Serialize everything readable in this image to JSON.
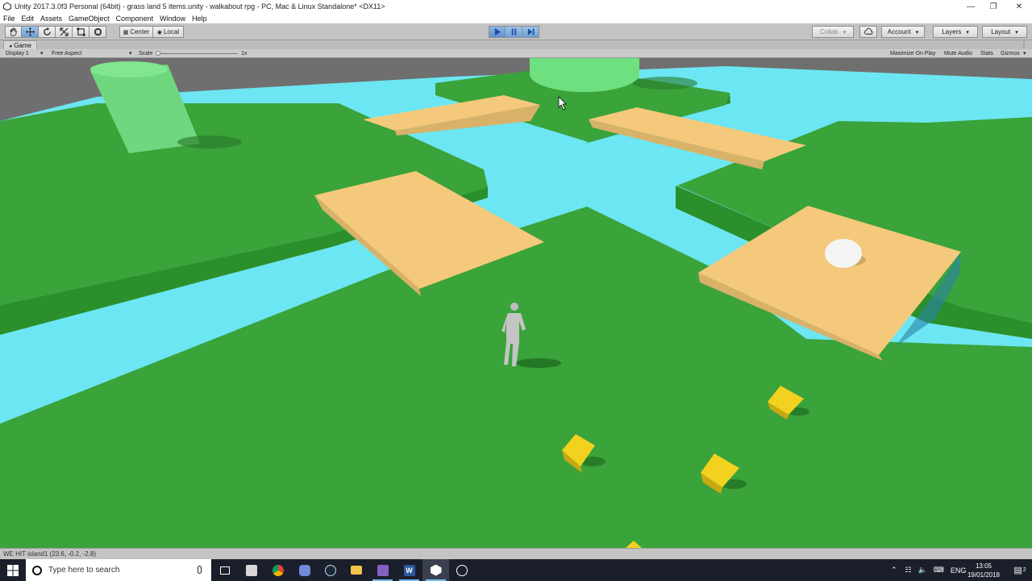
{
  "window": {
    "title": "Unity 2017.3.0f3 Personal (64bit) - grass land 5 items.unity - walkabout rpg - PC, Mac & Linux Standalone* <DX11>",
    "minimize_icon": "minimize-icon",
    "maximize_icon": "restore-icon",
    "close_icon": "close-icon"
  },
  "menu": [
    "File",
    "Edit",
    "Assets",
    "GameObject",
    "Component",
    "Window",
    "Help"
  ],
  "toolbar": {
    "tools": [
      "hand-tool-icon",
      "move-tool-icon",
      "rotate-tool-icon",
      "scale-tool-icon",
      "rect-tool-icon",
      "transform-tool-icon"
    ],
    "pivot_label": "Center",
    "space_label": "Local",
    "play_icon": "play-icon",
    "pause_icon": "pause-icon",
    "step_icon": "step-icon",
    "collab_label": "Collab",
    "account_label": "Account",
    "layers_label": "Layers",
    "layout_label": "Layout"
  },
  "game_tab": {
    "label": "Game",
    "display": "Display 1",
    "aspect": "Free Aspect",
    "scale_label": "Scale",
    "scale_value": "1x",
    "maximize_on_play": "Maximize On Play",
    "mute_audio": "Mute Audio",
    "stats": "Stats",
    "gizmos": "Gizmos"
  },
  "status": {
    "message": "WE HIT island1 (23.6, -0.2, -2.8)"
  },
  "taskbar": {
    "search_placeholder": "Type here to search",
    "apps": [
      "task-view-icon",
      "file-manager-icon",
      "chrome-icon",
      "discord-icon",
      "steam-icon",
      "file-explorer-icon",
      "visual-studio-icon",
      "word-icon",
      "unity-icon",
      "unity-hub-icon"
    ],
    "language": "ENG",
    "time": "13:05",
    "date": "19/01/2018",
    "notifications": "2"
  },
  "colors": {
    "grass": "#3aa33a",
    "grass_dark": "#2b8f2b",
    "water": "#6ce6f2",
    "bridge": "#f5c97b",
    "bridge_side": "#d8b268",
    "cube": "#f2d21e",
    "accent_blue": "#3c78c8"
  }
}
